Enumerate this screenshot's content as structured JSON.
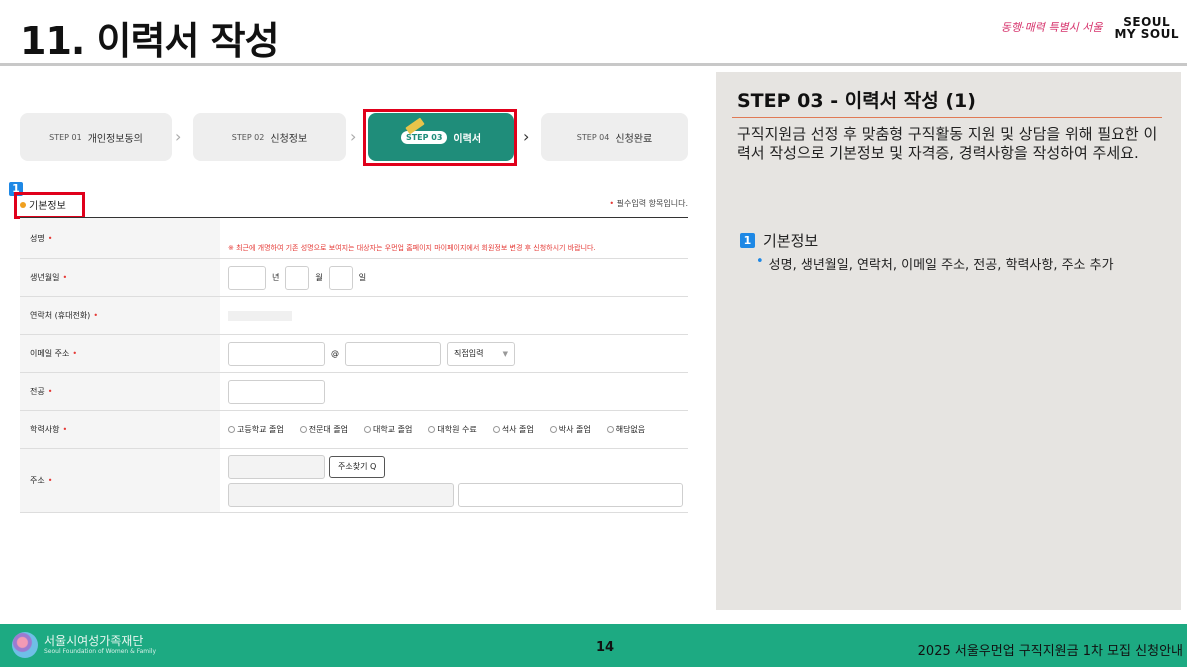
{
  "header": {
    "title": "11. 이력서 작성",
    "logo_left": "동행·매력 특별시 서울",
    "logo_right_line1": "SEOUL",
    "logo_right_line2": "MY SOUL"
  },
  "steps": [
    {
      "num": "STEP 01",
      "name": "개인정보동의"
    },
    {
      "num": "STEP 02",
      "name": "신청정보"
    },
    {
      "num": "STEP 03",
      "name": "이력서",
      "active": true
    },
    {
      "num": "STEP 04",
      "name": "신청완료"
    }
  ],
  "section": {
    "badge": "1",
    "title": "기본정보",
    "required_note": "필수입력 항목입니다."
  },
  "form": {
    "rows": [
      {
        "label": "성명",
        "required": true,
        "notice": "※ 최근에 개명하여 기존 성명으로 보여지는 대상자는 우먼업 홈페이지 마이페이지에서 회원정보 변경 후 신청하시기 바랍니다."
      },
      {
        "label": "생년월일",
        "required": true,
        "year_suffix": "년",
        "month_suffix": "월",
        "day_suffix": "일"
      },
      {
        "label": "연락처 (휴대전화)",
        "required": true
      },
      {
        "label": "이메일 주소",
        "required": true,
        "at": "@",
        "domain_select": "직접입력"
      },
      {
        "label": "전공",
        "required": true
      },
      {
        "label": "학력사항",
        "required": true,
        "options": [
          "고등학교 졸업",
          "전문대 졸업",
          "대학교 졸업",
          "대학원 수료",
          "석사 졸업",
          "박사 졸업",
          "해당없음"
        ]
      },
      {
        "label": "주소",
        "required": true,
        "button": "주소찾기 Q"
      }
    ]
  },
  "panel": {
    "title": "STEP 03 - 이력서 작성 (1)",
    "description": "구직지원금 선정 후 맞춤형 구직활동 지원 및 상담을 위해 필요한 이력서 작성으로 기본정보 및 자격증, 경력사항을 작성하여 주세요.",
    "section_badge": "1",
    "section_title": "기본정보",
    "bullet": "성명, 생년월일, 연락처, 이메일 주소, 전공, 학력사항, 주소 추가"
  },
  "footer": {
    "org_name": "서울시여성가족재단",
    "org_name_en": "Seoul Foundation of Women & Family",
    "page": "14",
    "doc_title": "2025 서울우먼업 구직지원금 1차 모집 신청안내"
  },
  "colors": {
    "accent_green": "#1daa82",
    "active_step": "#1f8d7a",
    "highlight_red": "#e0001b",
    "badge_blue": "#1e88e5",
    "panel_bg": "#e6e4e1"
  }
}
